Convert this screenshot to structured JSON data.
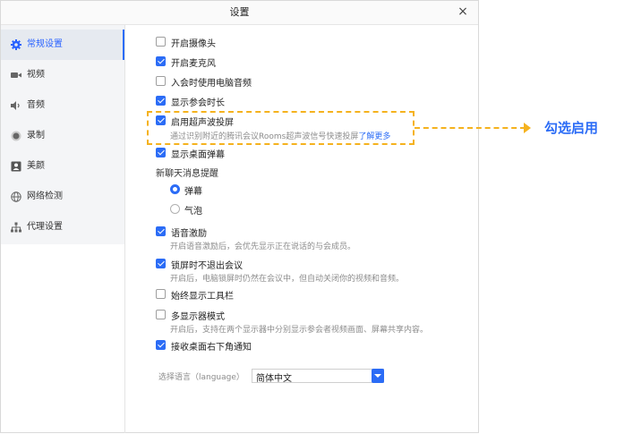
{
  "window": {
    "title": "设置",
    "close_glyph": "×"
  },
  "sidebar": {
    "items": [
      {
        "label": "常规设置",
        "icon": "gear-icon",
        "active": true
      },
      {
        "label": "视频",
        "icon": "video-camera-icon",
        "active": false
      },
      {
        "label": "音频",
        "icon": "speaker-icon",
        "active": false
      },
      {
        "label": "录制",
        "icon": "record-icon",
        "active": false
      },
      {
        "label": "美颜",
        "icon": "portrait-icon",
        "active": false
      },
      {
        "label": "网络检测",
        "icon": "globe-icon",
        "active": false
      },
      {
        "label": "代理设置",
        "icon": "network-tree-icon",
        "active": false
      }
    ]
  },
  "general": {
    "options": [
      {
        "label": "开启摄像头",
        "checked": false
      },
      {
        "label": "开启麦克风",
        "checked": true
      },
      {
        "label": "入会时使用电脑音频",
        "checked": false
      },
      {
        "label": "显示参会时长",
        "checked": true
      },
      {
        "label": "启用超声波投屏",
        "checked": true
      },
      {
        "label": "显示桌面弹幕",
        "checked": true
      },
      {
        "label": "语音激励",
        "checked": true
      },
      {
        "label": "锁屏时不退出会议",
        "checked": true
      },
      {
        "label": "始终显示工具栏",
        "checked": false
      },
      {
        "label": "多显示器模式",
        "checked": false
      },
      {
        "label": "接收桌面右下角通知",
        "checked": true
      }
    ],
    "ultrasound_desc": "通过识别附近的腾讯会议Rooms超声波信号快速投屏",
    "ultrasound_link": "了解更多",
    "chat_reminder_label": "新聊天消息提醒",
    "chat_reminder_options": [
      {
        "label": "弹幕",
        "checked": true
      },
      {
        "label": "气泡",
        "checked": false
      }
    ],
    "voice_desc": "开启语音激励后，会优先显示正在说话的与会成员。",
    "lockscreen_desc": "开启后，电脑锁屏时仍然在会议中，但自动关闭你的视频和音频。",
    "multi_display_desc": "开启后，支持在两个显示器中分别显示参会者视频画面、屏幕共享内容。",
    "language_label": "选择语言（language）",
    "language_value": "简体中文"
  },
  "annotation": {
    "text": "勾选启用",
    "color": "#2b6cf6",
    "highlight_color": "#f5b21e"
  },
  "colors": {
    "accent": "#2b6cf6",
    "sidebar_bg": "#f4f5f7"
  }
}
